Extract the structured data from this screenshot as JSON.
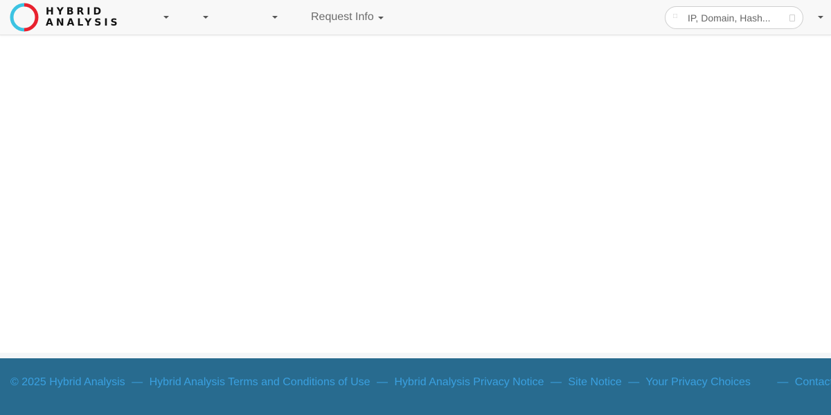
{
  "brand": {
    "line1": "HYBRID",
    "line2": "ANALYSIS",
    "ring_colors": [
      "#e8212e",
      "#3cc3e2"
    ]
  },
  "nav": {
    "request_info": "Request Info"
  },
  "search": {
    "placeholder": "IP, Domain, Hash..."
  },
  "footer": {
    "copyright": "© 2025 Hybrid Analysis",
    "sep": "—",
    "terms": "Hybrid Analysis Terms and Conditions of Use",
    "privacy": "Hybrid Analysis Privacy Notice",
    "site_notice": "Site Notice",
    "privacy_choices": "Your Privacy Choices",
    "contact": "Contact Us",
    "link_color": "#3aa0e0",
    "background": "#286b8f"
  }
}
